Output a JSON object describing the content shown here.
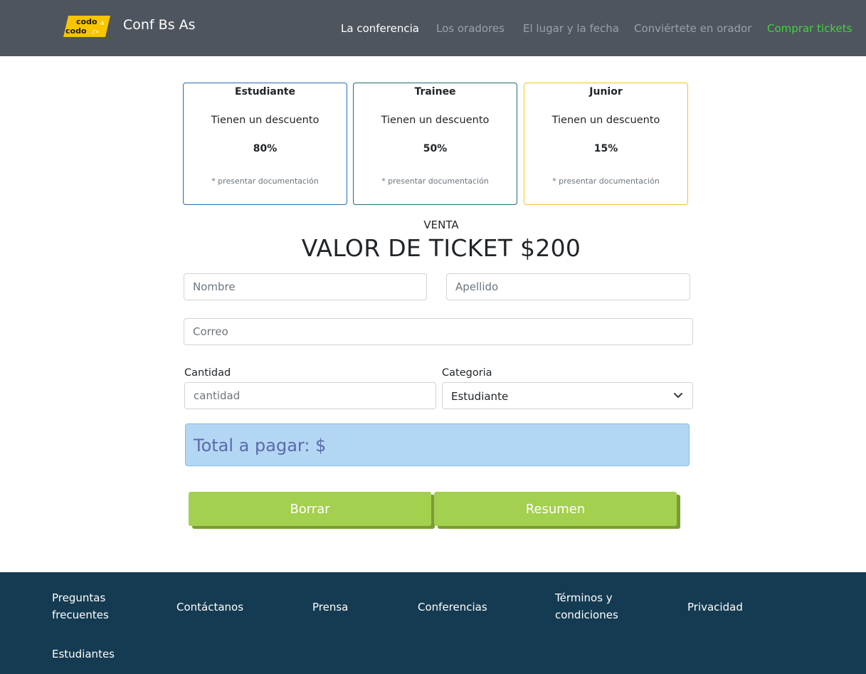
{
  "navbar": {
    "logo_text_top": "codo",
    "logo_text_bottom": "codo",
    "logo_a": "a",
    "brand": "Conf Bs As",
    "links": [
      {
        "label": "La conferencia"
      },
      {
        "label": "Los oradores"
      },
      {
        "label": "El lugar y la fecha"
      },
      {
        "label": "Conviértete en orador"
      },
      {
        "label": "Comprar tickets"
      }
    ]
  },
  "discounts": [
    {
      "title": "Estudiante",
      "text": "Tienen un descuento",
      "percent": "80%",
      "note": "* presentar documentación",
      "border_color": "#1f6fb2"
    },
    {
      "title": "Trainee",
      "text": "Tienen un descuento",
      "percent": "50%",
      "note": "* presentar documentación",
      "border_color": "#1e6e70"
    },
    {
      "title": "Junior",
      "text": "Tienen un descuento",
      "percent": "15%",
      "note": "* presentar documentación",
      "border_color": "#f2c230"
    }
  ],
  "sale": {
    "kicker": "VENTA",
    "heading": "VALOR DE TICKET $200"
  },
  "form": {
    "nombre_placeholder": "Nombre",
    "apellido_placeholder": "Apellido",
    "correo_placeholder": "Correo",
    "cantidad_label": "Cantidad",
    "cantidad_placeholder": "cantidad",
    "categoria_label": "Categoria",
    "categoria_value": "Estudiante",
    "total_text": "Total a pagar: $",
    "borrar_label": "Borrar",
    "resumen_label": "Resumen"
  },
  "footer": {
    "links": [
      {
        "line1": "Preguntas",
        "line2": "frecuentes"
      },
      {
        "line1": "Contáctanos",
        "line2": ""
      },
      {
        "line1": "Prensa",
        "line2": ""
      },
      {
        "line1": "Conferencias",
        "line2": ""
      },
      {
        "line1": "Términos y",
        "line2": "condiciones"
      },
      {
        "line1": "Privacidad",
        "line2": ""
      },
      {
        "line1": "Estudiantes",
        "line2": ""
      }
    ]
  },
  "colors": {
    "navbar_bg": "#4f555e",
    "tickets_link": "#3ed43e",
    "total_bg": "#b3d7f3",
    "button_bg": "#a4d04f",
    "footer_bg": "#153b52",
    "logo_yellow": "#f7c600"
  }
}
